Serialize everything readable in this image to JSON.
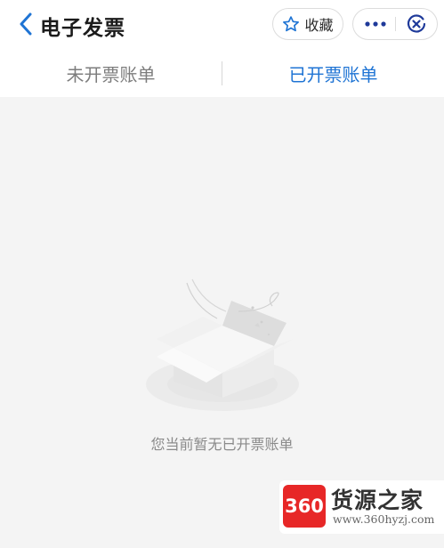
{
  "header": {
    "title": "电子发票",
    "favorite_label": "收藏"
  },
  "icons": {
    "back": "chevron-left-icon",
    "favorite": "star-outline-icon",
    "more": "ellipsis-icon",
    "close": "close-circle-icon"
  },
  "tabs": [
    {
      "label": "未开票账单",
      "active": false
    },
    {
      "label": "已开票账单",
      "active": true
    }
  ],
  "empty_state": {
    "illustration": "empty-box-icon",
    "message": "您当前暂无已开票账单"
  },
  "watermark": {
    "logo_text": "360",
    "title": "货源之家",
    "url": "www.360hyzj.com"
  },
  "colors": {
    "accent": "#1f74d4",
    "inactive_tab": "#7d7d7d",
    "background": "#f4f4f4",
    "logo_red": "#e72727"
  }
}
